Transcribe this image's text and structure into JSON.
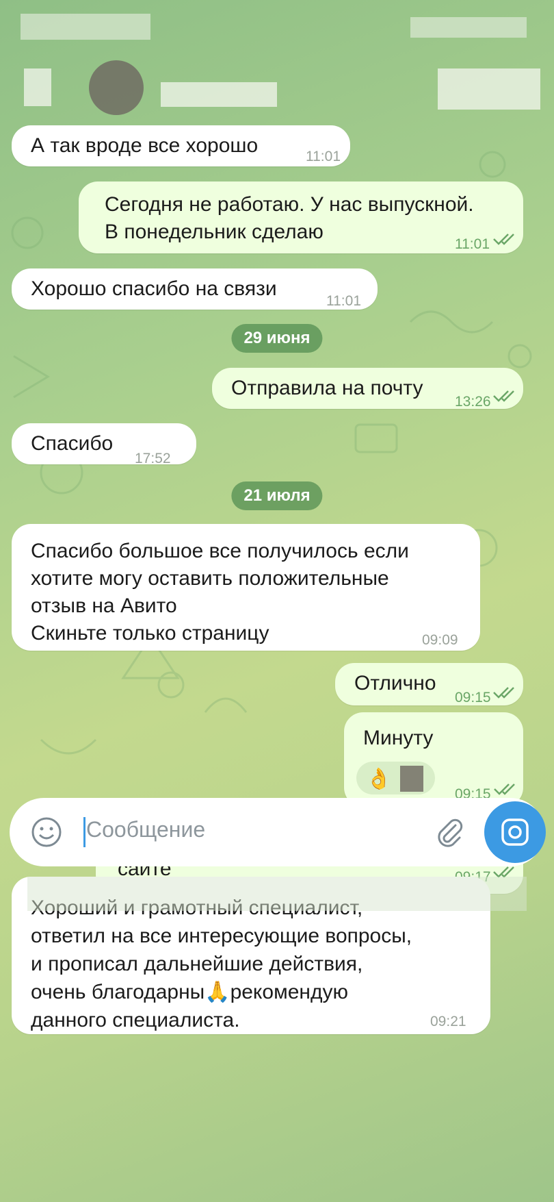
{
  "colors": {
    "incoming_bubble": "#ffffff",
    "outgoing_bubble": "#efffde",
    "read_check": "#6aa667",
    "date_pill": "#5f9a5c",
    "send_button": "#3c9ae3"
  },
  "messages": [
    {
      "dir": "in",
      "text": "А так вроде все хорошо",
      "time": "11:01"
    },
    {
      "dir": "out",
      "text": "Сегодня не работаю. У нас выпускной.\nВ понедельник сделаю",
      "time": "11:01",
      "read": true
    },
    {
      "dir": "in",
      "text": "Хорошо спасибо на связи",
      "time": "11:01"
    },
    {
      "dir": "date",
      "text": "29 июня"
    },
    {
      "dir": "out",
      "text": "Отправила на почту",
      "time": "13:26",
      "read": true
    },
    {
      "dir": "in",
      "text": "Спасибо",
      "time": "17:52"
    },
    {
      "dir": "date",
      "text": "21 июля"
    },
    {
      "dir": "in",
      "text": "Спасибо большое все получилось если\nхотите могу оставить положительные\nотзыв на Авито\nСкиньте только страницу",
      "time": "09:09"
    },
    {
      "dir": "out",
      "text": "Отлично",
      "time": "09:15",
      "read": true
    },
    {
      "dir": "out",
      "text": "Минуту",
      "time": "09:15",
      "read": true,
      "reaction": "👌"
    },
    {
      "dir": "out",
      "text": "Можете и тут написать, я размещу на\nсайте",
      "time": "09:17",
      "read": true
    },
    {
      "dir": "in",
      "text": "Хороший и грамотный специалист,\nответил на все интересующие вопросы,\nи прописал дальнейшие действия,\nочень благодарны🙏рекомендую\nданного специалиста.",
      "time": "09:21"
    }
  ],
  "composer": {
    "placeholder": "Сообщение",
    "emoji_icon": "smile-icon",
    "attach_icon": "paperclip-icon",
    "send_icon": "camera-icon"
  }
}
